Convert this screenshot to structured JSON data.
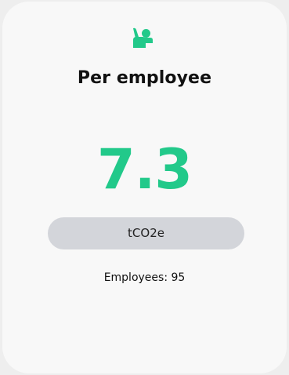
{
  "card": {
    "icon": "person-hand-raised-icon",
    "accent_color": "#22c98a",
    "title": "Per employee",
    "value": "7.3",
    "unit": "tCO2e",
    "employees_text": "Employees: 95"
  }
}
